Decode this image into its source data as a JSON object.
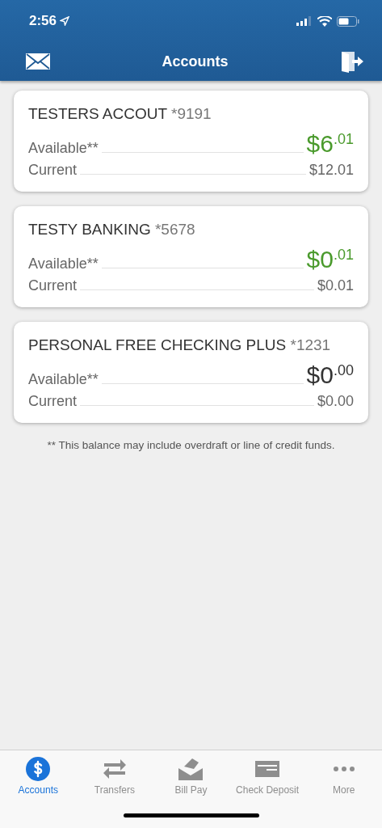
{
  "status_bar": {
    "time": "2:56"
  },
  "nav_bar": {
    "title": "Accounts"
  },
  "accounts": [
    {
      "name": "TESTERS ACCOUT",
      "number": "*9191",
      "available_label": "Available**",
      "available": "$6$^{.01}$",
      "color": "#4a9a2c",
      "current_label": "Current",
      "current": "$12.01"
    },
    {
      "name": "TESTY BANKING",
      "number": "*5678",
      "available_label": "Available**",
      "available": "$0$^{.01}$",
      "color": "#4a9a2c",
      "current_label": "Current",
      "current": "$0.01"
    },
    {
      "name": "PERSONAL FREE CHECKING PLUS",
      "number": "*1231",
      "available_label": "Available**",
      "available": "$0$^{.00}$",
      "color": "#333333",
      "current_label": "Current",
      "current": "$0.00"
    }
  ],
  "footnote": "** This balance may include overdraft or line of credit funds.",
  "tabs": [
    {
      "label": "Accounts",
      "kind": "dollar",
      "selected": true
    },
    {
      "label": "Transfers",
      "kind": "arrows",
      "selected": false
    },
    {
      "label": "Bill Pay",
      "kind": "envelope",
      "selected": false
    },
    {
      "label": "Check Deposit",
      "kind": "check",
      "selected": false
    },
    {
      "label": "More",
      "kind": "dots",
      "selected": false
    }
  ]
}
